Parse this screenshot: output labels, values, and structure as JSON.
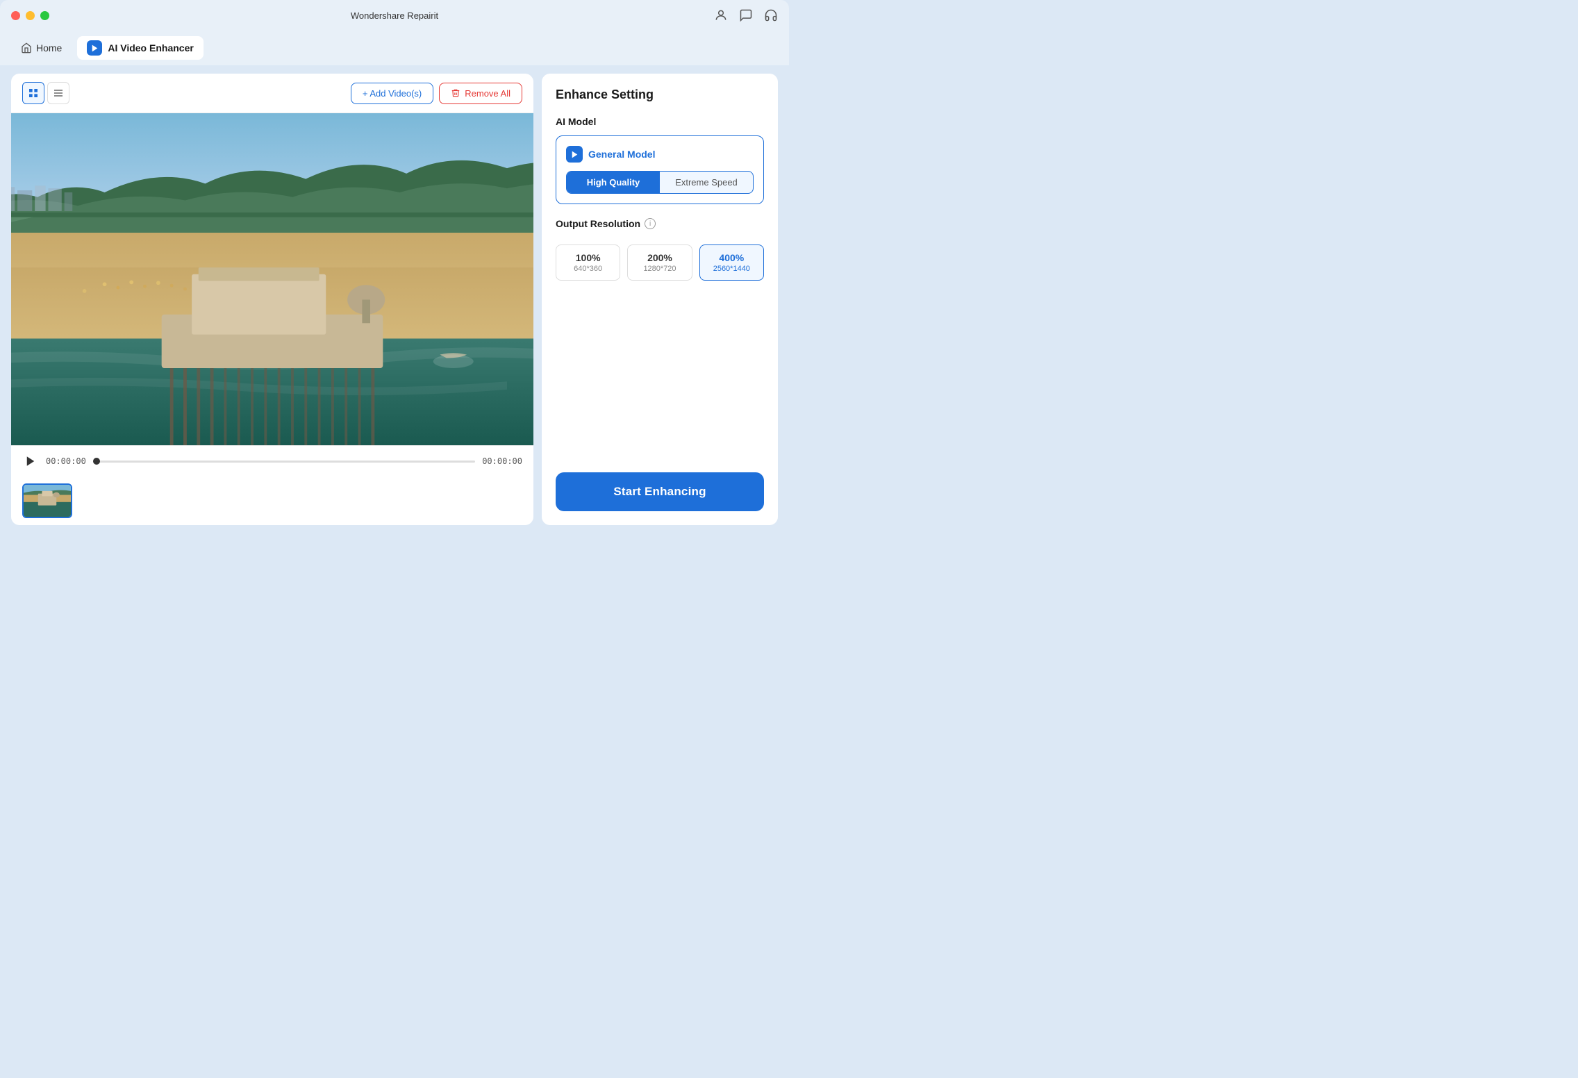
{
  "window": {
    "title": "Wondershare Repairit"
  },
  "nav": {
    "home_label": "Home",
    "active_label": "AI Video Enhancer"
  },
  "toolbar": {
    "add_btn_label": "+ Add Video(s)",
    "remove_btn_label": "Remove All"
  },
  "video_controls": {
    "current_time": "00:00:00",
    "total_time": "00:00:00"
  },
  "enhance_settings": {
    "title": "Enhance Setting",
    "ai_model_label": "AI Model",
    "model_name": "General Model",
    "quality_options": [
      "High Quality",
      "Extreme Speed"
    ],
    "selected_quality": "High Quality",
    "output_resolution_label": "Output Resolution",
    "resolutions": [
      {
        "percent": "100%",
        "dimension": "640*360"
      },
      {
        "percent": "200%",
        "dimension": "1280*720"
      },
      {
        "percent": "400%",
        "dimension": "2560*1440"
      }
    ],
    "selected_resolution_index": 2,
    "start_btn_label": "Start Enhancing"
  }
}
